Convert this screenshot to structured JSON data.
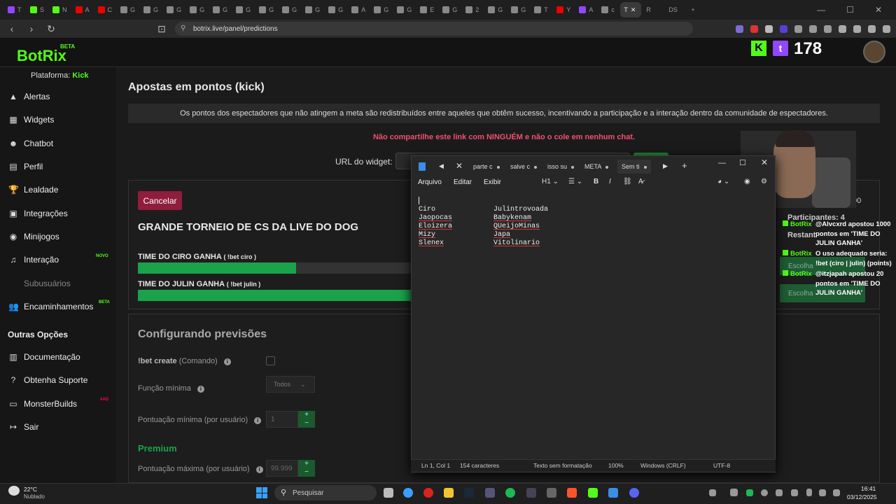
{
  "browser": {
    "tabs": [
      {
        "label": "T",
        "color": "#9147ff"
      },
      {
        "label": "S",
        "color": "#53fc18"
      },
      {
        "label": "N",
        "color": "#53fc18"
      },
      {
        "label": "A",
        "color": "#e00"
      },
      {
        "label": "C",
        "color": "#e00"
      },
      {
        "label": "G",
        "color": "#888"
      },
      {
        "label": "G",
        "color": "#888"
      },
      {
        "label": "G",
        "color": "#888"
      },
      {
        "label": "G",
        "color": "#888"
      },
      {
        "label": "G",
        "color": "#888"
      },
      {
        "label": "G",
        "color": "#888"
      },
      {
        "label": "G",
        "color": "#888"
      },
      {
        "label": "G",
        "color": "#888"
      },
      {
        "label": "G",
        "color": "#888"
      },
      {
        "label": "G",
        "color": "#888"
      },
      {
        "label": "A",
        "color": "#888"
      },
      {
        "label": "G",
        "color": "#888"
      },
      {
        "label": "G",
        "color": "#888"
      },
      {
        "label": "E",
        "color": "#888"
      },
      {
        "label": "G",
        "color": "#888"
      },
      {
        "label": "2",
        "color": "#888"
      },
      {
        "label": "G",
        "color": "#888"
      },
      {
        "label": "G",
        "color": "#888"
      },
      {
        "label": "T",
        "color": "#888"
      },
      {
        "label": "Y",
        "color": "#e00"
      },
      {
        "label": "A",
        "color": "#9147ff"
      },
      {
        "label": "c",
        "color": "#888"
      }
    ],
    "active_tab": "T",
    "extra_tabs": [
      "R",
      "DS"
    ],
    "url": "botrix.live/panel/predictions"
  },
  "header": {
    "logo": "BotRix",
    "beta": "BETA",
    "kick": "K",
    "twitch": "t",
    "points": "178"
  },
  "sidebar": {
    "platform_label": "Plataforma:",
    "platform_value": "Kick",
    "items": [
      {
        "label": "Alertas",
        "icon": "▲"
      },
      {
        "label": "Widgets",
        "icon": "▦"
      },
      {
        "label": "Chatbot",
        "icon": "☻"
      },
      {
        "label": "Perfil",
        "icon": "▤"
      },
      {
        "label": "Lealdade",
        "icon": "🏆"
      },
      {
        "label": "Integrações",
        "icon": "▣"
      },
      {
        "label": "Minijogos",
        "icon": "◉"
      },
      {
        "label": "Interação",
        "icon": "♫"
      },
      {
        "label": "Subusuários",
        "icon": ""
      },
      {
        "label": "Encaminhamentos",
        "icon": "👥"
      }
    ],
    "tag_new": "NOVO",
    "tag_beta": "BETA",
    "section": "Outras Opções",
    "other_items": [
      {
        "label": "Documentação",
        "icon": "▥"
      },
      {
        "label": "Obtenha Suporte",
        "icon": "?"
      },
      {
        "label": "MonsterBuilds",
        "icon": "▭"
      },
      {
        "label": "Sair",
        "icon": "↦"
      }
    ],
    "tag_ad": "#AD"
  },
  "main": {
    "title": "Apostas em pontos (kick)",
    "info": "Os pontos dos espectadores que não atingem a meta são redistribuídos entre aqueles que obtêm sucesso, incentivando a participação e a interação dentro da comunidade de espectadores.",
    "warning": "Não compartilhe este link com NINGUÉM e não o cole em nenhum chat.",
    "url_label": "URL do widget:",
    "cancel": "Cancelar",
    "prediction_title": "GRANDE TORNEIO DE CS DA LIVE DO DOG",
    "options": [
      {
        "label": "TIME DO CIRO GANHA",
        "cmd": "( !bet ciro )",
        "fill": 0.58
      },
      {
        "label": "TIME DO JULIN GANHA",
        "cmd": "( !bet julin )",
        "fill": 1.0
      }
    ],
    "participants": "Participantes: 4",
    "remaining": "Restant",
    "top_right": "00",
    "choose": "Escolha",
    "config_title": "Configurando previsões",
    "bet_create": "!bet create",
    "bet_create_sub": "(Comando)",
    "min_role_label": "Função mínima",
    "min_role_value": "Todos",
    "min_points_label": "Pontuação mínima (por usuário)",
    "min_points_value": "1",
    "premium": "Premium",
    "max_points_label": "Pontuação máxima (por usuário)",
    "max_points_value": "99.999"
  },
  "chat": [
    {
      "user": "BotRix",
      "text": "@Alvcxrd apostou 1000 pontos em 'TIME DO JULIN GANHA'"
    },
    {
      "user": "BotRix",
      "text": "O uso adequado seria: !bet (ciro | julin) (points)"
    },
    {
      "user": "BotRix",
      "text": "@itzjapah apostou 20 pontos em 'TIME DO JULIN GANHA'"
    }
  ],
  "notepad": {
    "tabs": [
      "parte c",
      "salve c",
      "isso su",
      "META",
      "Sem ti"
    ],
    "menu": [
      "Arquivo",
      "Editar",
      "Exibir"
    ],
    "heading": "H1",
    "col1": [
      "Ciro",
      "Jaopocas",
      "Eloizera",
      "Mizy",
      "Slenex"
    ],
    "col2": [
      "Julintrovoada",
      "Babykenam",
      "QUeijoMinas",
      "Japa",
      "Vitolinario"
    ],
    "status": [
      "Ln 1, Col 1",
      "154 caracteres",
      "Texto sem formatação",
      "100%",
      "Windows (CRLF)",
      "UTF-8"
    ]
  },
  "taskbar": {
    "temp": "22°C",
    "weather": "Nublado",
    "search": "Pesquisar",
    "time": "16:41",
    "date": "03/12/2025"
  }
}
